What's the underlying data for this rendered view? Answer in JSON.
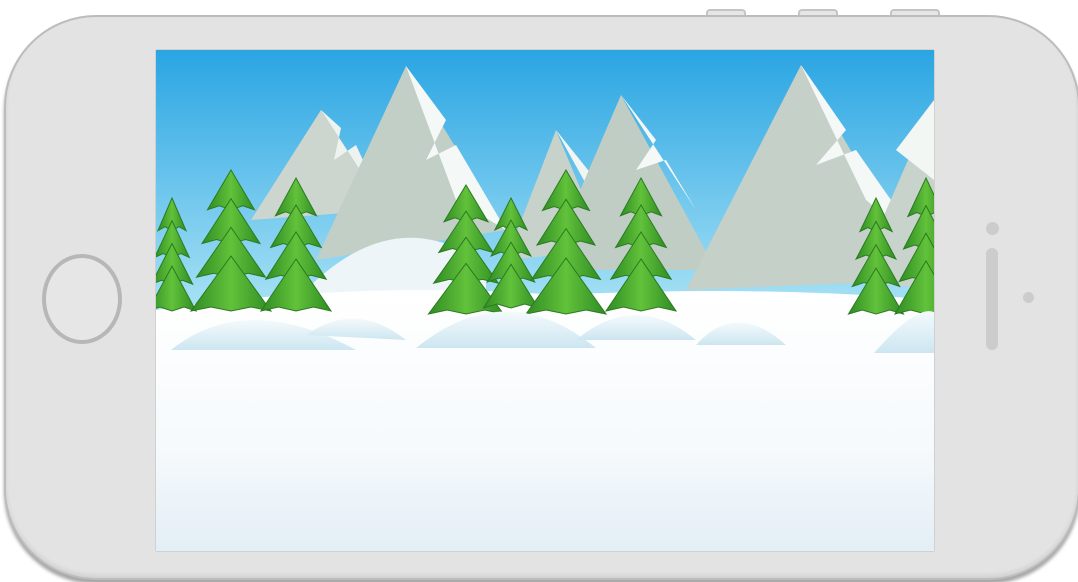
{
  "device": {
    "type": "phone",
    "orientation": "landscape",
    "body_color": "#e3e3e3"
  },
  "scene": {
    "sky_top_color": "#2aa5e3",
    "sky_bottom_color": "#a8e2f5",
    "snow_color": "#f7fbfd",
    "tree_color": "#3f9a2a",
    "mountain_color": "#c6d4c9"
  }
}
